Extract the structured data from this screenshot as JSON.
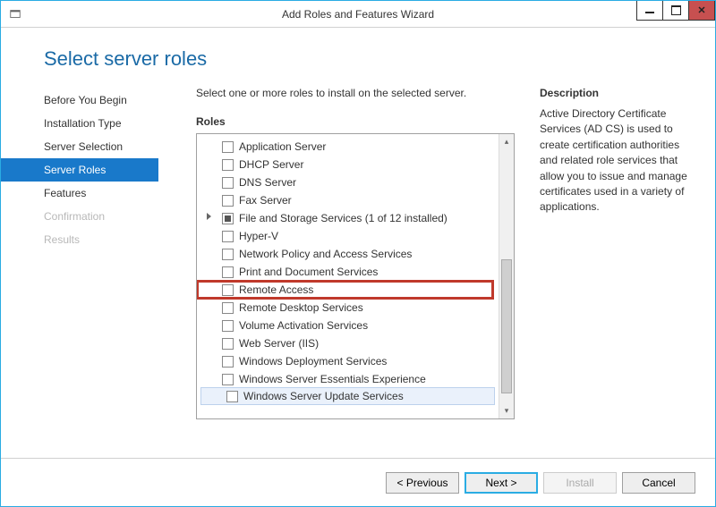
{
  "window": {
    "title": "Add Roles and Features Wizard"
  },
  "page": {
    "heading": "Select server roles",
    "prompt": "Select one or more roles to install on the selected server.",
    "roles_label": "Roles"
  },
  "nav": [
    {
      "label": "Before You Begin",
      "state": "normal"
    },
    {
      "label": "Installation Type",
      "state": "normal"
    },
    {
      "label": "Server Selection",
      "state": "normal"
    },
    {
      "label": "Server Roles",
      "state": "selected"
    },
    {
      "label": "Features",
      "state": "normal"
    },
    {
      "label": "Confirmation",
      "state": "disabled"
    },
    {
      "label": "Results",
      "state": "disabled"
    }
  ],
  "roles": [
    {
      "label": "Application Server",
      "checked": false
    },
    {
      "label": "DHCP Server",
      "checked": false
    },
    {
      "label": "DNS Server",
      "checked": false
    },
    {
      "label": "Fax Server",
      "checked": false
    },
    {
      "label": "File and Storage Services (1 of 12 installed)",
      "checked": "partial",
      "expandable": true
    },
    {
      "label": "Hyper-V",
      "checked": false
    },
    {
      "label": "Network Policy and Access Services",
      "checked": false
    },
    {
      "label": "Print and Document Services",
      "checked": false
    },
    {
      "label": "Remote Access",
      "checked": false,
      "highlight": true
    },
    {
      "label": "Remote Desktop Services",
      "checked": false
    },
    {
      "label": "Volume Activation Services",
      "checked": false
    },
    {
      "label": "Web Server (IIS)",
      "checked": false
    },
    {
      "label": "Windows Deployment Services",
      "checked": false
    },
    {
      "label": "Windows Server Essentials Experience",
      "checked": false
    },
    {
      "label": "Windows Server Update Services",
      "checked": false,
      "selected": true
    }
  ],
  "description": {
    "title": "Description",
    "body": "Active Directory Certificate Services (AD CS) is used to create certification authorities and related role services that allow you to issue and manage certificates used in a variety of applications."
  },
  "buttons": {
    "previous": "< Previous",
    "next": "Next >",
    "install": "Install",
    "cancel": "Cancel"
  }
}
